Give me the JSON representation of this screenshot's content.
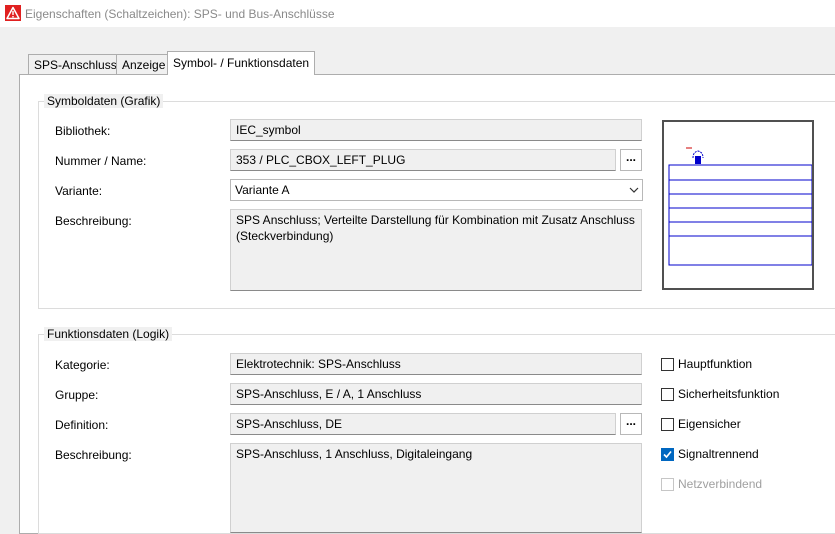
{
  "window": {
    "title": "Eigenschaften (Schaltzeichen): SPS- und Bus-Anschlüsse",
    "icon": "warning-triangle-app-icon"
  },
  "tabs": [
    {
      "label": "SPS-Anschluss",
      "active": false
    },
    {
      "label": "Anzeige",
      "active": false
    },
    {
      "label": "Symbol- / Funktionsdaten",
      "active": true
    }
  ],
  "symbol_group": {
    "title": "Symboldaten (Grafik)",
    "library_label": "Bibliothek:",
    "library_value": "IEC_symbol",
    "number_label": "Nummer / Name:",
    "number_value": "353 / PLC_CBOX_LEFT_PLUG",
    "browse_label": "...",
    "variant_label": "Variante:",
    "variant_value": "Variante A",
    "description_label": "Beschreibung:",
    "description_value": "SPS Anschluss; Verteilte Darstellung für Kombination mit Zusatz Anschluss (Steckverbindung)",
    "preview_icon": "symbol-preview"
  },
  "function_group": {
    "title": "Funktionsdaten (Logik)",
    "category_label": "Kategorie:",
    "category_value": "Elektrotechnik: SPS-Anschluss",
    "group_label": "Gruppe:",
    "group_value": "SPS-Anschluss, E / A, 1 Anschluss",
    "definition_label": "Definition:",
    "definition_value": "SPS-Anschluss, DE",
    "browse_label": "...",
    "description_label": "Beschreibung:",
    "description_value": "SPS-Anschluss, 1 Anschluss, Digitaleingang",
    "checkboxes": [
      {
        "label": "Hauptfunktion",
        "checked": false,
        "enabled": true
      },
      {
        "label": "Sicherheitsfunktion",
        "checked": false,
        "enabled": true
      },
      {
        "label": "Eigensicher",
        "checked": false,
        "enabled": true
      },
      {
        "label": "Signaltrennend",
        "checked": true,
        "enabled": true
      },
      {
        "label": "Netzverbindend",
        "checked": false,
        "enabled": false
      }
    ]
  },
  "colors": {
    "accent": "#0067c0",
    "field_bg": "#f0f0f0",
    "app_icon": "#e02020"
  }
}
